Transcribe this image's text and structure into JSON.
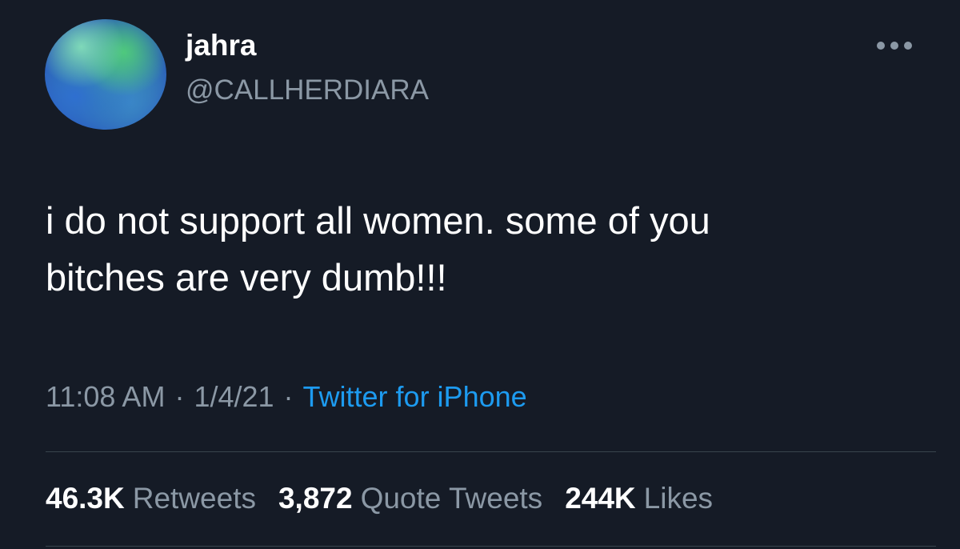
{
  "user": {
    "display_name": "jahra",
    "handle": "@CALLHERDIARA"
  },
  "more_icon": "ellipsis-icon",
  "tweet": {
    "text_line1": "i do not support all women. some of you",
    "text_line2": "bitches are very dumb!!!"
  },
  "meta": {
    "time": "11:08 AM",
    "separator": "·",
    "date": "1/4/21",
    "source": "Twitter for iPhone"
  },
  "stats": {
    "retweets_count": "46.3K",
    "retweets_label": "Retweets",
    "quotes_count": "3,872",
    "quotes_label": "Quote Tweets",
    "likes_count": "244K",
    "likes_label": "Likes"
  },
  "colors": {
    "background": "#151b26",
    "text_primary": "#ffffff",
    "text_secondary": "#8b98a5",
    "link": "#1d9bf0",
    "divider": "#38444d"
  }
}
